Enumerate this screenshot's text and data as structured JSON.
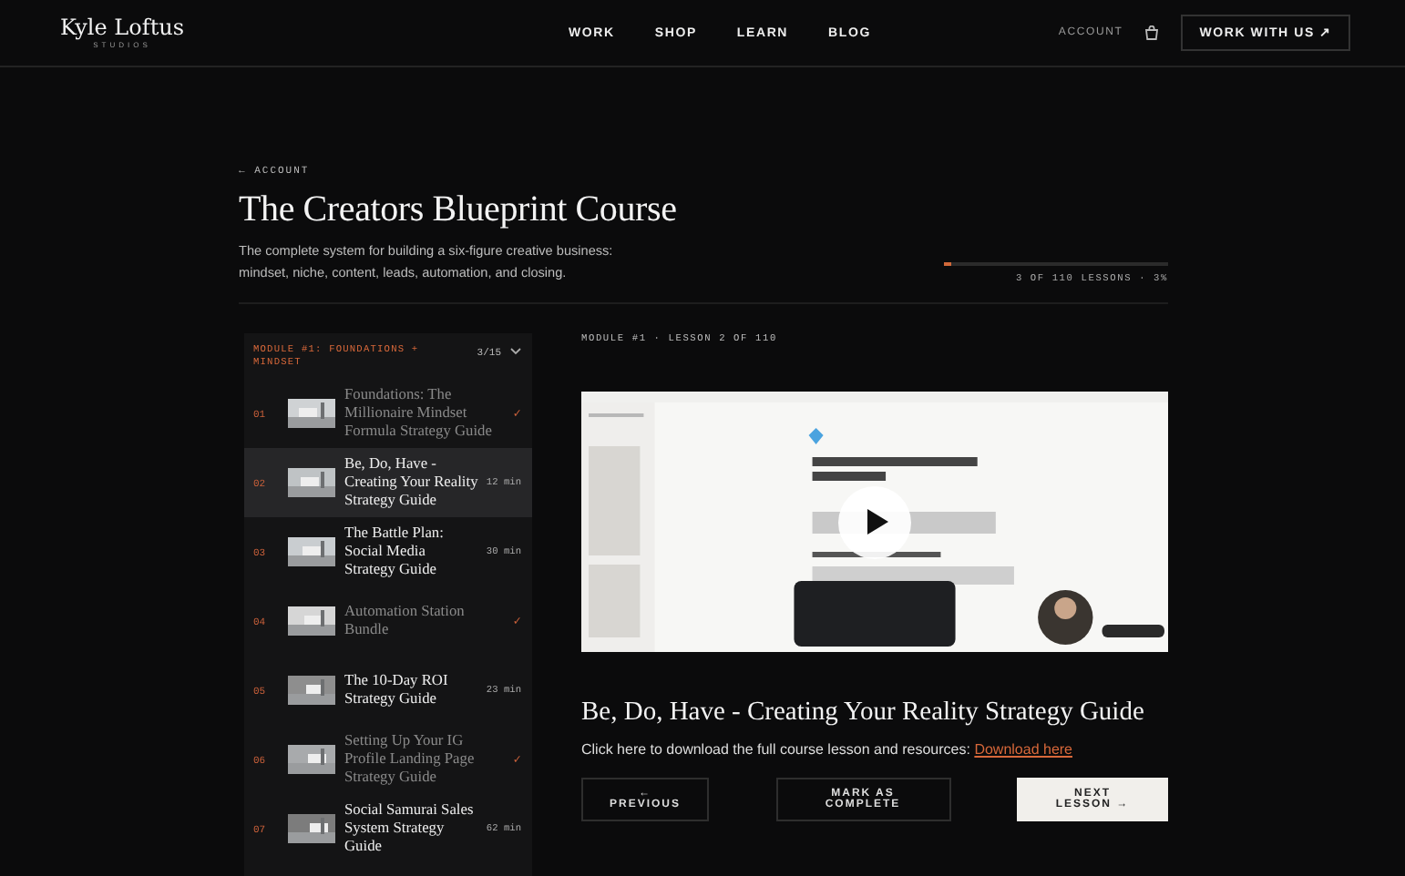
{
  "brand": {
    "name": "Kyle Loftus",
    "sub": "STUDIOS"
  },
  "nav": [
    {
      "label": "WORK"
    },
    {
      "label": "SHOP"
    },
    {
      "label": "LEARN"
    },
    {
      "label": "BLOG"
    }
  ],
  "account_link": "ACCOUNT",
  "cta": "WORK WITH US ↗",
  "back_link": "← ACCOUNT",
  "course": {
    "title": "The Creators Blueprint Course",
    "description": "The complete system for building a six-figure creative business: mindset, niche, content, leads, automation, and closing.",
    "progress": {
      "level": 0.03,
      "label": "3 OF 110 LESSONS · 3%"
    }
  },
  "module": {
    "title": "MODULE #1: FOUNDATIONS + MINDSET",
    "count": "3/15",
    "expanded": true,
    "lessons": [
      {
        "number": "01",
        "title": "Foundations: The Millionaire Mindset Formula Strategy Guide",
        "completed": true,
        "selected": false,
        "duration": "✓"
      },
      {
        "number": "02",
        "title": "Be, Do, Have - Creating Your Reality Strategy Guide",
        "completed": false,
        "selected": true,
        "duration": "12 min"
      },
      {
        "number": "03",
        "title": "The Battle Plan: Social Media Strategy Guide",
        "completed": false,
        "selected": false,
        "duration": "30 min"
      },
      {
        "number": "04",
        "title": "Automation Station Bundle",
        "completed": true,
        "selected": false,
        "duration": "✓"
      },
      {
        "number": "05",
        "title": "The 10-Day ROI Strategy Guide",
        "completed": false,
        "selected": false,
        "duration": "23 min"
      },
      {
        "number": "06",
        "title": "Setting Up Your IG Profile Landing Page Strategy Guide",
        "completed": true,
        "selected": false,
        "duration": "✓"
      },
      {
        "number": "07",
        "title": "Social Samurai Sales System Strategy Guide",
        "completed": false,
        "selected": false,
        "duration": "62 min"
      }
    ]
  },
  "lesson": {
    "eyebrow": "MODULE #1 · LESSON 2 OF 110",
    "title": "Be, Do, Have - Creating Your Reality Strategy Guide",
    "download_text": "Click here to download the full course lesson and resources:",
    "download_link": "Download here"
  },
  "buttons": [
    {
      "label": "← PREVIOUS",
      "kind": "outline"
    },
    {
      "label": "MARK AS COMPLETE",
      "kind": "outline"
    },
    {
      "label": "NEXT LESSON →",
      "kind": "solid"
    }
  ]
}
